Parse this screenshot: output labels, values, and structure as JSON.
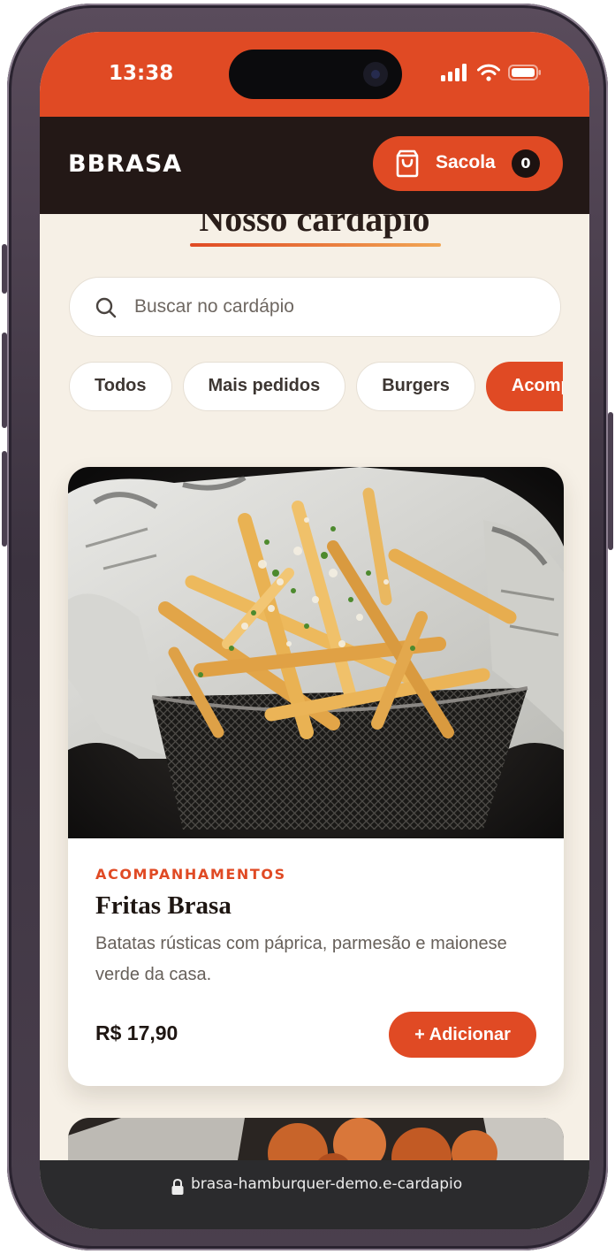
{
  "status_bar": {
    "time": "13:38",
    "icons": [
      "cellular-signal-icon",
      "wifi-icon",
      "battery-icon"
    ]
  },
  "header": {
    "brand": "BBRASA",
    "bag": {
      "label": "Sacola",
      "count": "0",
      "icon": "shopping-bag-icon"
    }
  },
  "menu": {
    "title": "Nosso cardápio",
    "search": {
      "placeholder": "Buscar no cardápio",
      "value": "",
      "icon": "search-icon"
    },
    "filters": [
      {
        "label": "Todos",
        "active": false
      },
      {
        "label": "Mais pedidos",
        "active": false
      },
      {
        "label": "Burgers",
        "active": false
      },
      {
        "label": "Acompanhamentos",
        "active": true
      }
    ]
  },
  "product": {
    "category": "ACOMPANHAMENTOS",
    "name": "Fritas Brasa",
    "description": "Batatas rústicas com páprica, parmesão e maionese verde da casa.",
    "price": "R$ 17,90",
    "add_label": "+ Adicionar"
  },
  "browser": {
    "url": "brasa-hamburquer-demo.e-cardapio",
    "icon": "lock-icon"
  },
  "colors": {
    "accent": "#e04a24",
    "header_dark": "#231816",
    "background": "#f6f0e6"
  }
}
